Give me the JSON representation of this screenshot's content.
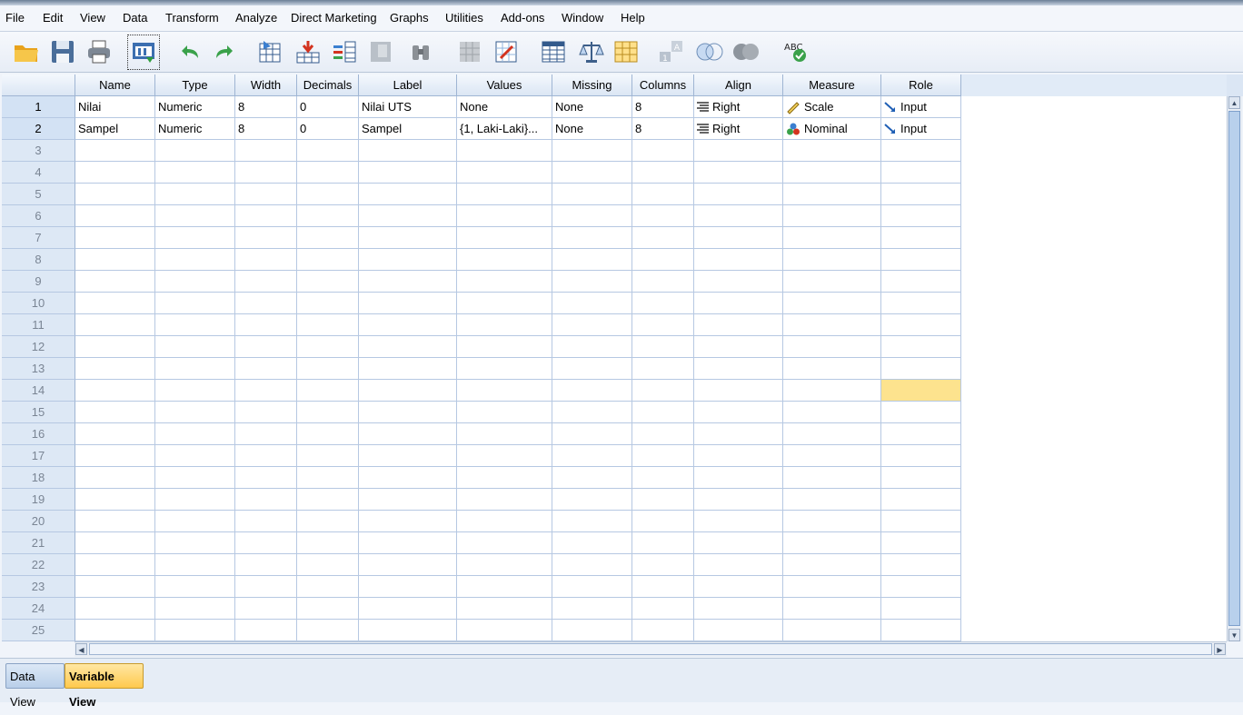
{
  "menu": [
    "File",
    "Edit",
    "View",
    "Data",
    "Transform",
    "Analyze",
    "Direct Marketing",
    "Graphs",
    "Utilities",
    "Add-ons",
    "Window",
    "Help"
  ],
  "toolbar": [
    "open-folder-icon",
    "save-icon",
    "print-icon",
    "recall-dialog-icon",
    "undo-icon",
    "redo-icon",
    "goto-case-icon",
    "goto-variable-icon",
    "variables-icon",
    "run-descriptives-icon",
    "find-icon",
    "insert-cases-icon",
    "insert-variable-icon",
    "split-file-icon",
    "weight-cases-icon",
    "select-cases-icon",
    "value-labels-icon",
    "use-sets-icon",
    "show-all-variables-icon",
    "spell-check-icon"
  ],
  "columns": [
    "Name",
    "Type",
    "Width",
    "Decimals",
    "Label",
    "Values",
    "Missing",
    "Columns",
    "Align",
    "Measure",
    "Role"
  ],
  "variables": [
    {
      "row": "1",
      "name": "Nilai",
      "type": "Numeric",
      "width": "8",
      "decimals": "0",
      "label": "Nilai UTS",
      "values": "None",
      "missing": "None",
      "columns": "8",
      "align": "Right",
      "measure": "Scale",
      "role": "Input"
    },
    {
      "row": "2",
      "name": "Sampel",
      "type": "Numeric",
      "width": "8",
      "decimals": "0",
      "label": "Sampel",
      "values": "{1, Laki-Laki}...",
      "missing": "None",
      "columns": "8",
      "align": "Right",
      "measure": "Nominal",
      "role": "Input"
    }
  ],
  "empty_rows": [
    "3",
    "4",
    "5",
    "6",
    "7",
    "8",
    "9",
    "10",
    "11",
    "12",
    "13",
    "14",
    "15",
    "16",
    "17",
    "18",
    "19",
    "20",
    "21",
    "22",
    "23",
    "24",
    "25"
  ],
  "selected_cell": {
    "row": "14",
    "column": "Role"
  },
  "colors": {
    "selected": "#fde38e",
    "header": "#dbe6f4",
    "active_tab": "#ffc94d"
  },
  "tabs": {
    "data_view": "Data View",
    "variable_view": "Variable View",
    "active": "Variable View"
  }
}
